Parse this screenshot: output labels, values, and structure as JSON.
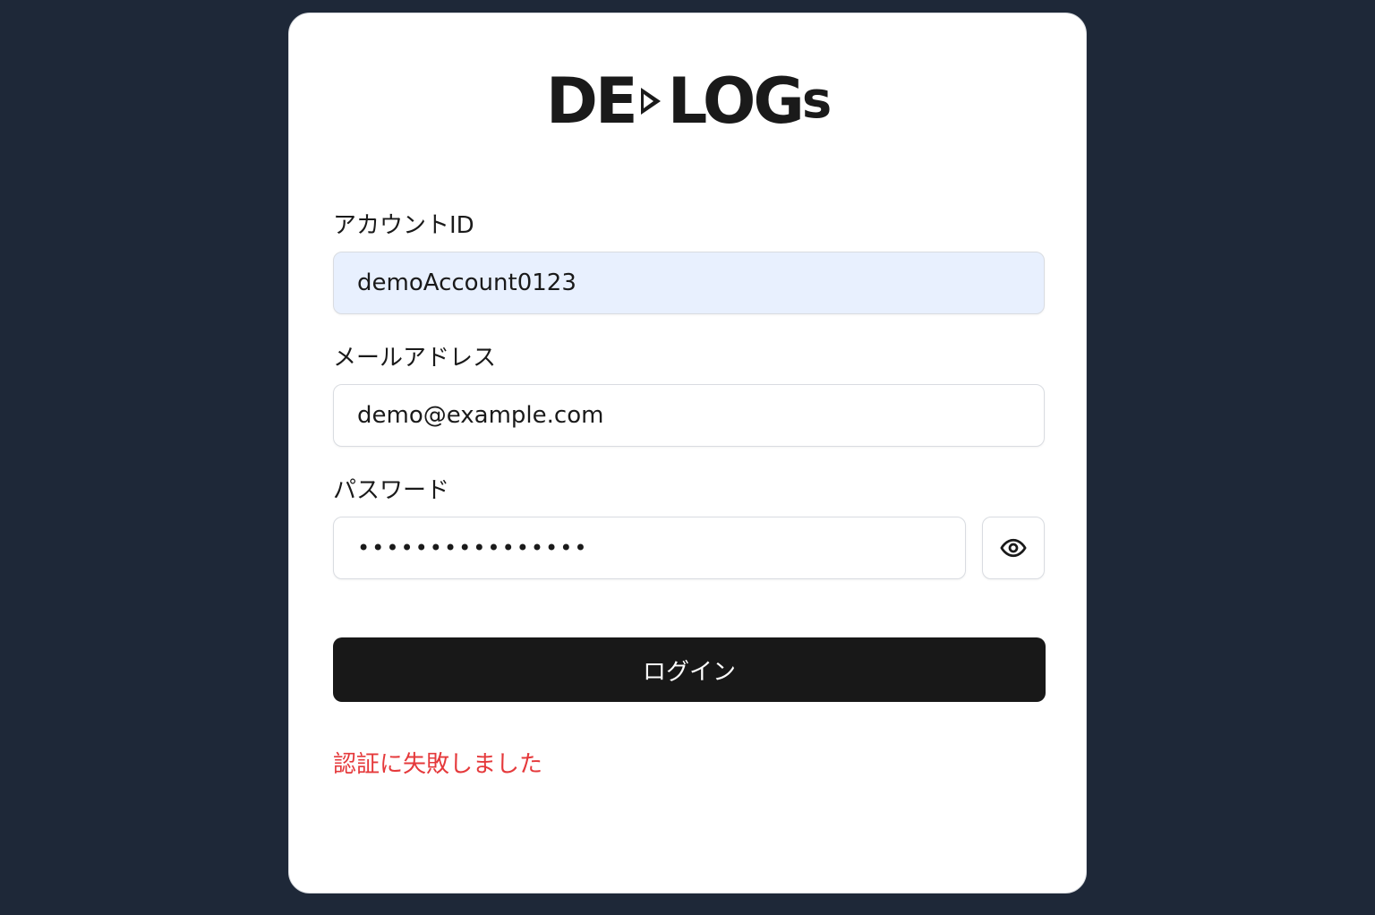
{
  "brand": {
    "part1": "DE",
    "part2": "LOG",
    "part3": "s"
  },
  "form": {
    "account_id": {
      "label": "アカウントID",
      "value": "demoAccount0123"
    },
    "email": {
      "label": "メールアドレス",
      "value": "demo@example.com"
    },
    "password": {
      "label": "パスワード",
      "value": "••••••••••••••••"
    },
    "toggle_icon": "eye-icon",
    "submit_label": "ログイン",
    "error_message": "認証に失敗しました"
  },
  "colors": {
    "background": "#1e2838",
    "button": "#181818",
    "error": "#e5393b",
    "autofill": "#e8f0fe"
  }
}
